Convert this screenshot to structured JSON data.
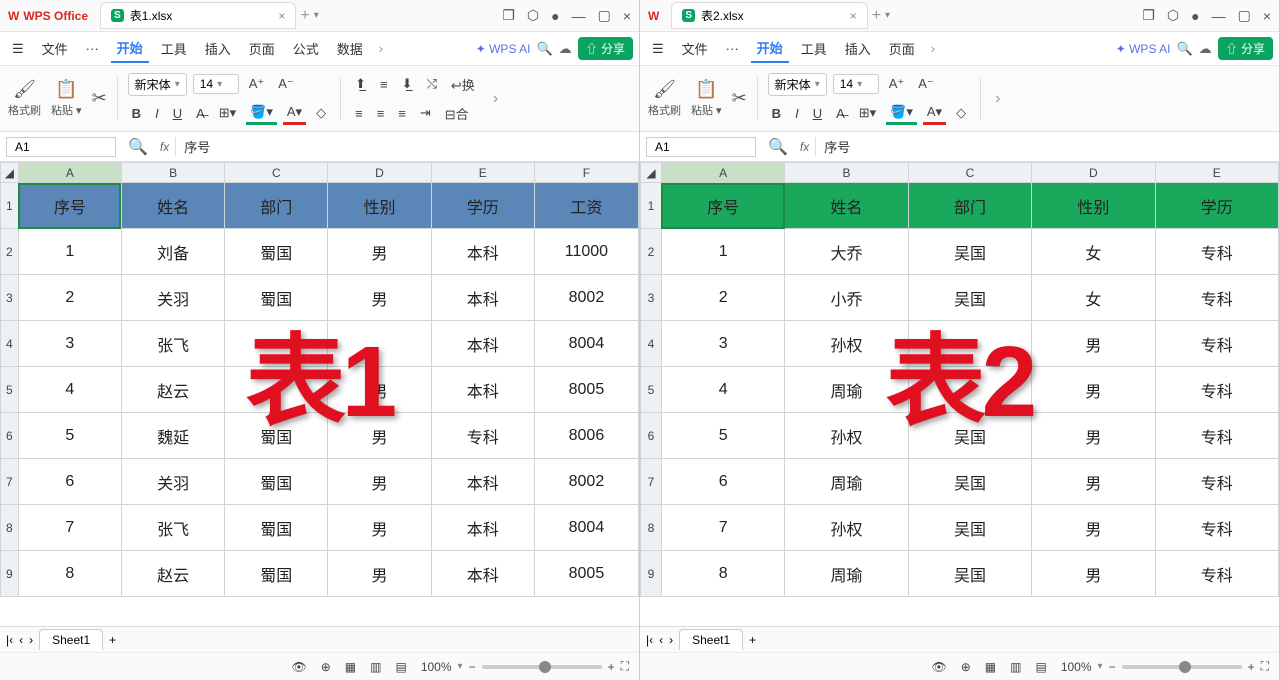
{
  "left": {
    "appName": "WPS Office",
    "tabName": "表1.xlsx",
    "menu": {
      "file": "文件",
      "start": "开始",
      "tool": "工具",
      "insert": "插入",
      "page": "页面",
      "formula": "公式",
      "data": "数据"
    },
    "ai": "WPS AI",
    "share": "分享",
    "ribbon": {
      "formatBrush": "格式刷",
      "paste": "粘贴",
      "font": "新宋体",
      "size": "14"
    },
    "nameBox": "A1",
    "fx": "fx",
    "formulaVal": "序号",
    "cols": [
      "A",
      "B",
      "C",
      "D",
      "E",
      "F"
    ],
    "headers": [
      "序号",
      "姓名",
      "部门",
      "性别",
      "学历",
      "工资"
    ],
    "rows": [
      [
        "1",
        "刘备",
        "蜀国",
        "男",
        "本科",
        "11000"
      ],
      [
        "2",
        "关羽",
        "蜀国",
        "男",
        "本科",
        "8002"
      ],
      [
        "3",
        "张飞",
        "",
        "",
        "本科",
        "8004"
      ],
      [
        "4",
        "赵云",
        "",
        "男",
        "本科",
        "8005"
      ],
      [
        "5",
        "魏延",
        "蜀国",
        "男",
        "专科",
        "8006"
      ],
      [
        "6",
        "关羽",
        "蜀国",
        "男",
        "本科",
        "8002"
      ],
      [
        "7",
        "张飞",
        "蜀国",
        "男",
        "本科",
        "8004"
      ],
      [
        "8",
        "赵云",
        "蜀国",
        "男",
        "本科",
        "8005"
      ]
    ],
    "sheet": "Sheet1",
    "zoom": "100%",
    "overlay": "表1"
  },
  "right": {
    "tabName": "表2.xlsx",
    "menu": {
      "file": "文件",
      "start": "开始",
      "tool": "工具",
      "insert": "插入",
      "page": "页面"
    },
    "ai": "WPS AI",
    "share": "分享",
    "ribbon": {
      "formatBrush": "格式刷",
      "paste": "粘贴",
      "font": "新宋体",
      "size": "14"
    },
    "nameBox": "A1",
    "fx": "fx",
    "formulaVal": "序号",
    "cols": [
      "A",
      "B",
      "C",
      "D",
      "E"
    ],
    "headers": [
      "序号",
      "姓名",
      "部门",
      "性别",
      "学历"
    ],
    "rows": [
      [
        "1",
        "大乔",
        "吴国",
        "女",
        "专科"
      ],
      [
        "2",
        "小乔",
        "吴国",
        "女",
        "专科"
      ],
      [
        "3",
        "孙权",
        "",
        "男",
        "专科"
      ],
      [
        "4",
        "周瑜",
        "",
        "男",
        "专科"
      ],
      [
        "5",
        "孙权",
        "吴国",
        "男",
        "专科"
      ],
      [
        "6",
        "周瑜",
        "吴国",
        "男",
        "专科"
      ],
      [
        "7",
        "孙权",
        "吴国",
        "男",
        "专科"
      ],
      [
        "8",
        "周瑜",
        "吴国",
        "男",
        "专科"
      ]
    ],
    "sheet": "Sheet1",
    "zoom": "100%",
    "overlay": "表2"
  }
}
